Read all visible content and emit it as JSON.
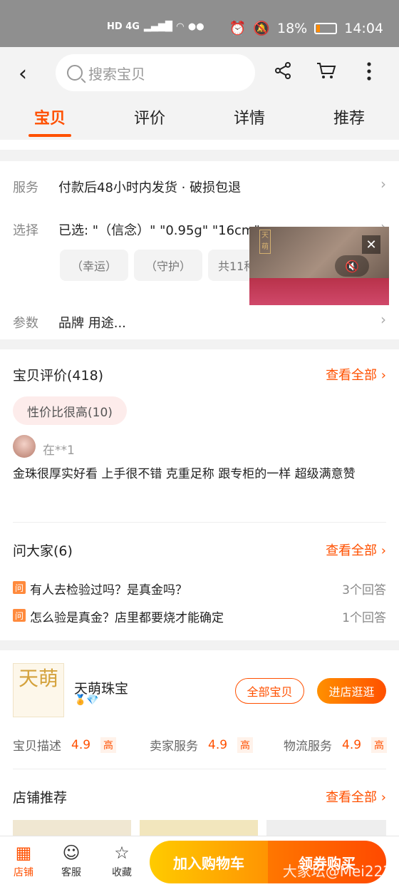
{
  "status_bar": {
    "left_text": "HD 4G",
    "battery": "18%",
    "time": "14:04",
    "battery_level": 0.18
  },
  "header": {
    "search_placeholder": "搜索宝贝",
    "tabs": [
      "宝贝",
      "评价",
      "详情",
      "推荐"
    ]
  },
  "service": {
    "label": "服务",
    "value": "付款后48小时内发货 · 破损包退"
  },
  "select": {
    "label": "选择",
    "value": "已选: \"（信念）\" \"0.95g\" \"16cm\"",
    "chips": [
      "（幸运）",
      "（守护）",
      "共11种"
    ]
  },
  "params": {
    "label": "参数",
    "value": "品牌 用途..."
  },
  "video": {
    "logo": "天萌"
  },
  "reviews": {
    "title": "宝贝评价(418)",
    "see_all": "查看全部",
    "tag": "性价比很高(10)",
    "user": "在**1",
    "text": "金珠很厚实好看 上手很不错 克重足称 跟专柜的一样  超级满意赞"
  },
  "qa": {
    "title": "问大家(6)",
    "see_all": "查看全部",
    "badge": "问",
    "items": [
      {
        "q": "有人去检验过吗？是真金吗？",
        "count": "3个回答"
      },
      {
        "q": "怎么验是真金？店里都要烧才能确定",
        "count": "1个回答"
      }
    ]
  },
  "shop": {
    "logo_text": "天萌",
    "name": "天萌珠宝",
    "btn_all": "全部宝贝",
    "btn_enter": "进店逛逛",
    "scores": [
      {
        "label": "宝贝描述",
        "value": "4.9",
        "level": "高"
      },
      {
        "label": "卖家服务",
        "value": "4.9",
        "level": "高"
      },
      {
        "label": "物流服务",
        "value": "4.9",
        "level": "高"
      }
    ]
  },
  "recommend": {
    "title": "店铺推荐",
    "see_all": "查看全部"
  },
  "bottom_bar": {
    "items": [
      {
        "label": "店铺",
        "icon": "shop-icon"
      },
      {
        "label": "客服",
        "icon": "chat-icon"
      },
      {
        "label": "收藏",
        "icon": "star-icon"
      }
    ],
    "add_cart": "加入购物车",
    "buy": "领券购买",
    "watermark": "大家坛@Mei222"
  }
}
